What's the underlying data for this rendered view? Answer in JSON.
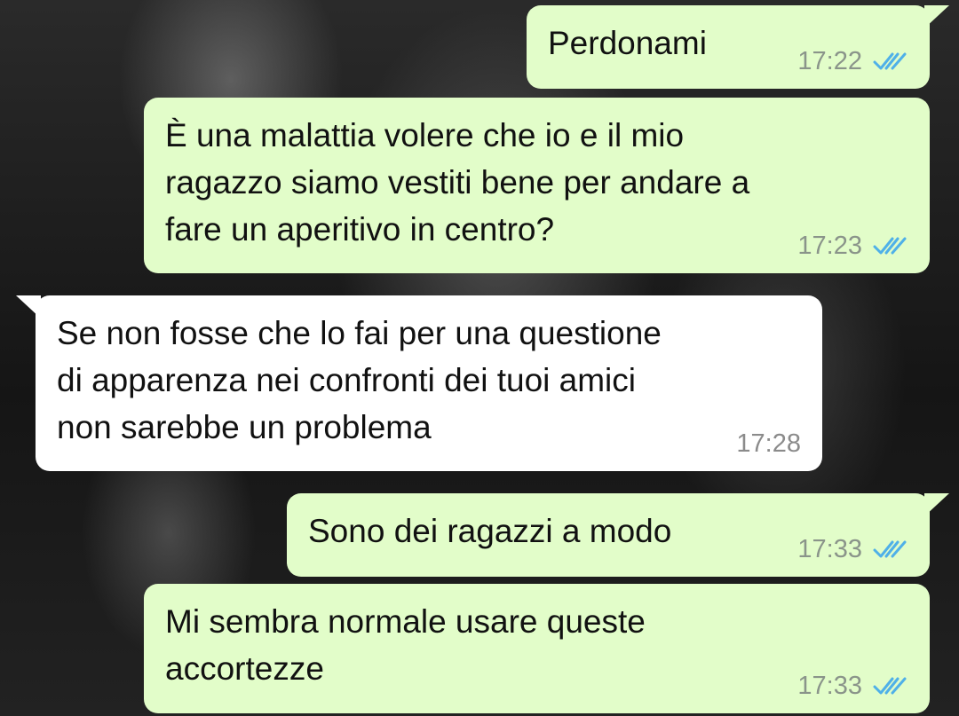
{
  "messages": [
    {
      "direction": "outgoing",
      "text": "Perdonami",
      "time": "17:22",
      "status_icon": "double-check-read-icon"
    },
    {
      "direction": "outgoing",
      "text": "È una malattia volere che io e il mio\nragazzo siamo vestiti bene per andare a\nfare un aperitivo in centro?",
      "time": "17:23",
      "status_icon": "double-check-read-icon"
    },
    {
      "direction": "incoming",
      "text": "Se non fosse che lo fai per una questione\ndi apparenza nei confronti dei tuoi amici\nnon sarebbe un problema",
      "time": "17:28"
    },
    {
      "direction": "outgoing",
      "text": "Sono dei ragazzi a modo",
      "time": "17:33",
      "status_icon": "double-check-read-icon"
    },
    {
      "direction": "outgoing",
      "text": "Mi sembra normale usare queste\naccortezze",
      "time": "17:33",
      "status_icon": "double-check-read-icon"
    }
  ],
  "colors": {
    "outgoing_bubble": "#e2fdc9",
    "incoming_bubble": "#ffffff",
    "read_ticks": "#4fb0e8",
    "timestamp": "#8a948a"
  }
}
